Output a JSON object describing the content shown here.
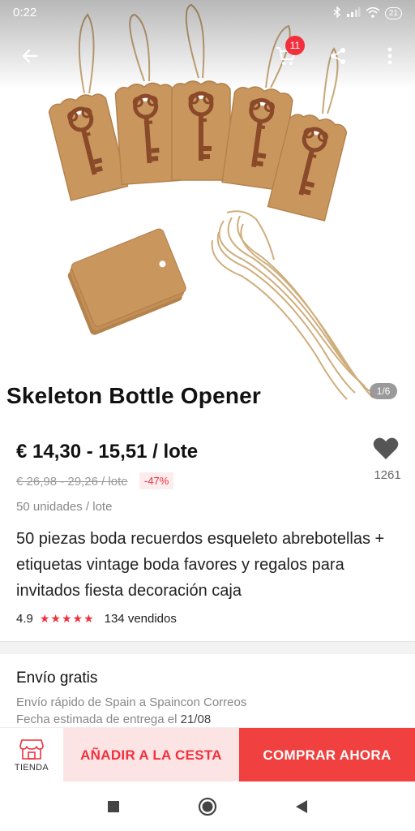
{
  "status_bar": {
    "time": "0:22",
    "battery": "21"
  },
  "header": {
    "cart_badge": "11",
    "icons": [
      "back-arrow-icon",
      "cart-icon",
      "share-icon",
      "more-vertical-icon"
    ]
  },
  "gallery": {
    "counter": "1/6",
    "title": "Skeleton Bottle Opener"
  },
  "product": {
    "price": "€ 14,30 - 15,51 / lote",
    "old_price": "€ 26,98 - 29,26 / lote",
    "discount": "-47%",
    "units": "50 unidades / lote",
    "wishlist_count": "1261",
    "description": "50 piezas boda recuerdos esqueleto abrebotellas + etiquetas vintage boda favores y regalos para invitados fiesta decoración caja",
    "rating": "4.9",
    "stars": "★★★★★",
    "sold": "134 vendidos"
  },
  "shipping": {
    "title": "Envío gratis",
    "line1": "Envío rápido de Spain a Spaincon Correos",
    "line2_prefix": "Fecha estimada de entrega el ",
    "date": "21/08"
  },
  "actions": {
    "store_label": "TIENDA",
    "add_to_cart": "AÑADIR A LA CESTA",
    "buy_now": "COMPRAR AHORA"
  },
  "colors": {
    "accent": "#f2303d",
    "buy_bg": "#f0403f",
    "cart_bg": "#fde4e4",
    "kraft": "#c9975e"
  }
}
